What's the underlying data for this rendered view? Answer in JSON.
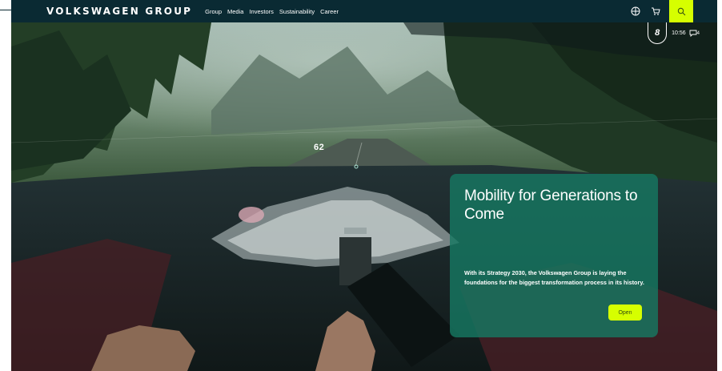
{
  "header": {
    "brand": "VOLKSWAGEN GROUP",
    "nav": [
      "Group",
      "Media",
      "Investors",
      "Sustainability",
      "Career"
    ],
    "icons": {
      "language": "globe-icon",
      "cart": "cart-icon",
      "search": "search-icon"
    }
  },
  "hero": {
    "speed": "62",
    "gauge": "8",
    "clock": "10:56",
    "messages": "4"
  },
  "card": {
    "title": "Mobility for Generations to Come",
    "text": "With its Strategy 2030, the Volkswagen Group is laying the foundations for the biggest transformation process in its history.",
    "button": "Open"
  },
  "colors": {
    "nav_background": "#0a2a33",
    "accent": "#d6ff00",
    "card_background": "#167862"
  }
}
